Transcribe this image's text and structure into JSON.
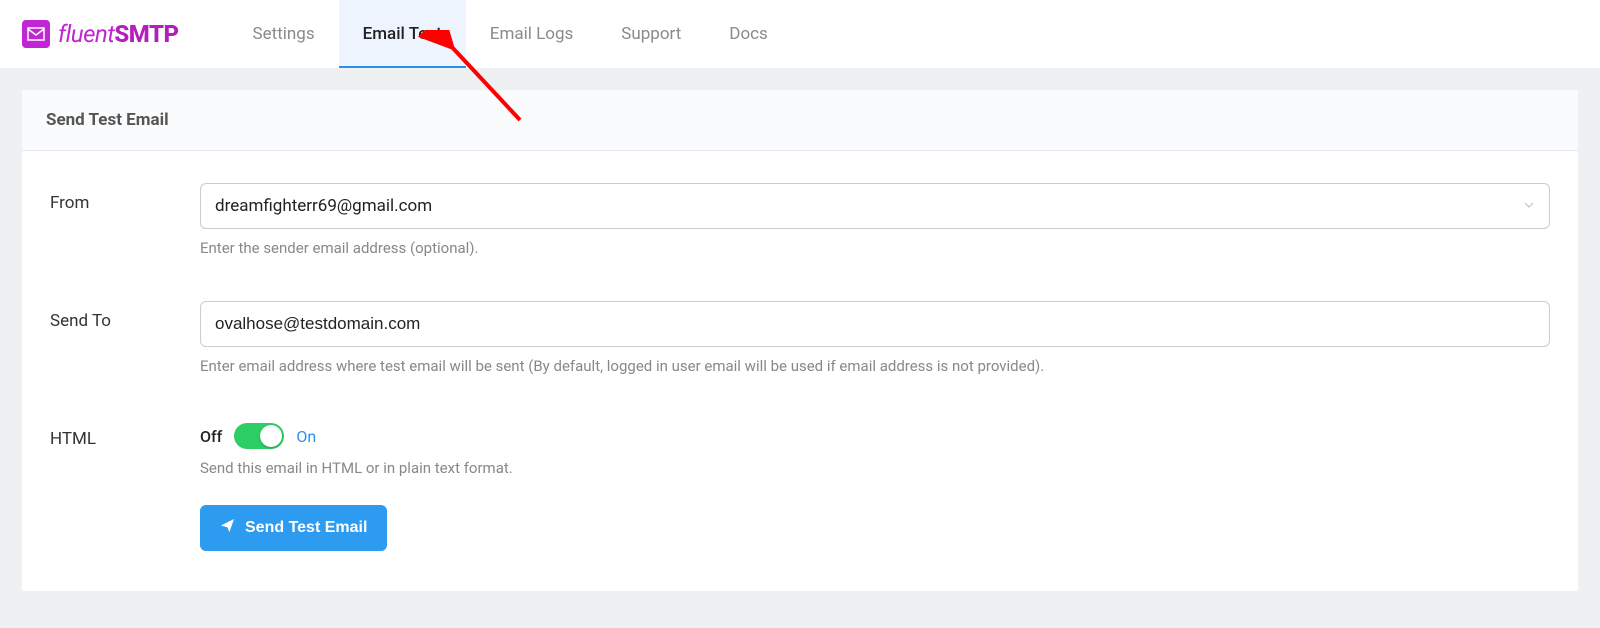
{
  "logo": {
    "word1": "fluent",
    "word2": "SMTP"
  },
  "nav": {
    "settings": "Settings",
    "email_test": "Email Test",
    "email_logs": "Email Logs",
    "support": "Support",
    "docs": "Docs"
  },
  "card": {
    "title": "Send Test Email"
  },
  "from": {
    "label": "From",
    "value": "dreamfighterr69@gmail.com",
    "help": "Enter the sender email address (optional)."
  },
  "sendto": {
    "label": "Send To",
    "value": "ovalhose@testdomain.com",
    "help": "Enter email address where test email will be sent (By default, logged in user email will be used if email address is not provided)."
  },
  "html": {
    "label": "HTML",
    "off": "Off",
    "on": "On",
    "help": "Send this email in HTML or in plain text format."
  },
  "button": {
    "label": "Send Test Email"
  }
}
